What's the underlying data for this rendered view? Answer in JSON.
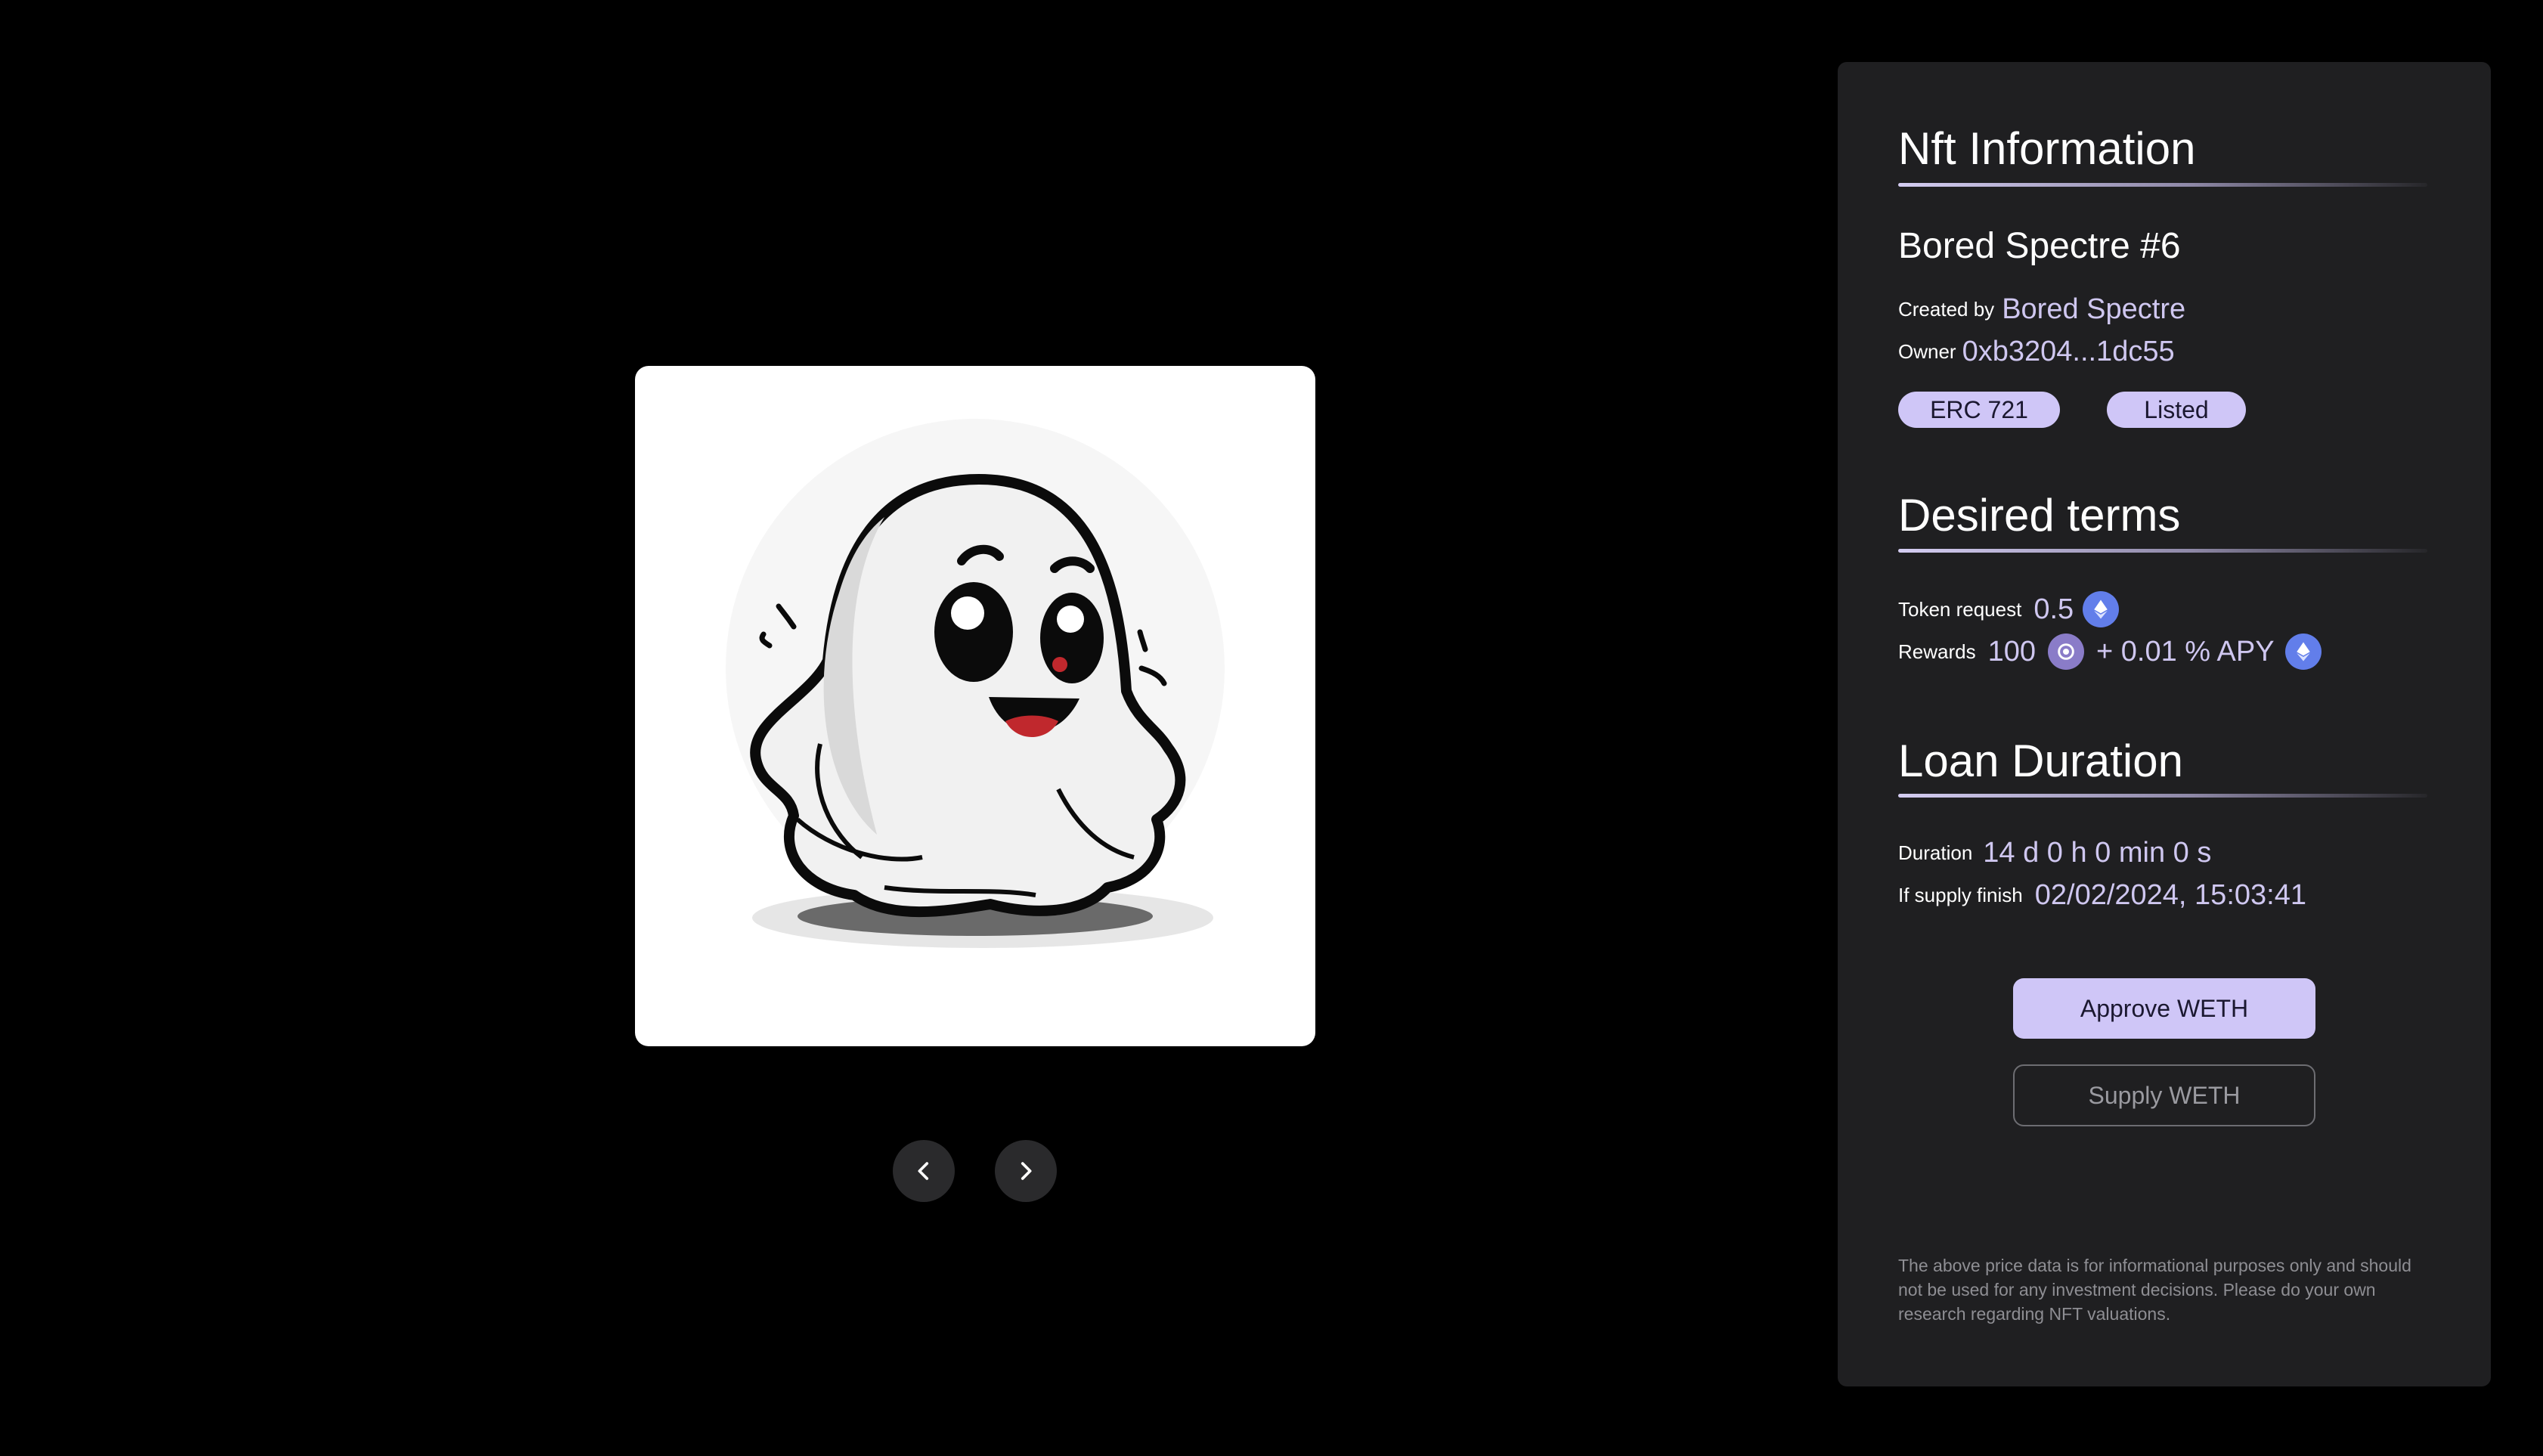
{
  "nft": {
    "image_alt": "ghost illustration",
    "prev_icon": "chevron-left-icon",
    "next_icon": "chevron-right-icon"
  },
  "panel": {
    "info_title": "Nft Information",
    "nft_name": "Bored Spectre #6",
    "created_by_label": "Created by",
    "created_by_value": "Bored Spectre",
    "owner_label": "Owner",
    "owner_value": "0xb3204...1dc55",
    "badges": [
      "ERC 721",
      "Listed"
    ],
    "terms_title": "Desired terms",
    "token_request_label": "Token request",
    "token_request_value": "0.5",
    "token_request_icon": "ethereum-icon",
    "rewards_label": "Rewards",
    "rewards_value": "100",
    "rewards_token_icon": "reward-token-icon",
    "rewards_apy": "+ 0.01 % APY",
    "rewards_apy_icon": "ethereum-icon",
    "duration_title": "Loan Duration",
    "duration_label": "Duration",
    "duration_value": "14 d 0 h 0 min 0 s",
    "supply_finish_label": "If supply finish",
    "supply_finish_value": "02/02/2024, 15:03:41",
    "approve_button": "Approve WETH",
    "supply_button": "Supply WETH",
    "disclaimer": "The above price data is for informational purposes only and should not be used for any investment decisions. Please do your own research regarding NFT valuations."
  },
  "colors": {
    "accent": "#cfc6f7",
    "accent_text": "#cfc7f0",
    "panel_bg": "#1f1f21",
    "page_bg": "#000000",
    "eth_blue": "#627eea"
  }
}
